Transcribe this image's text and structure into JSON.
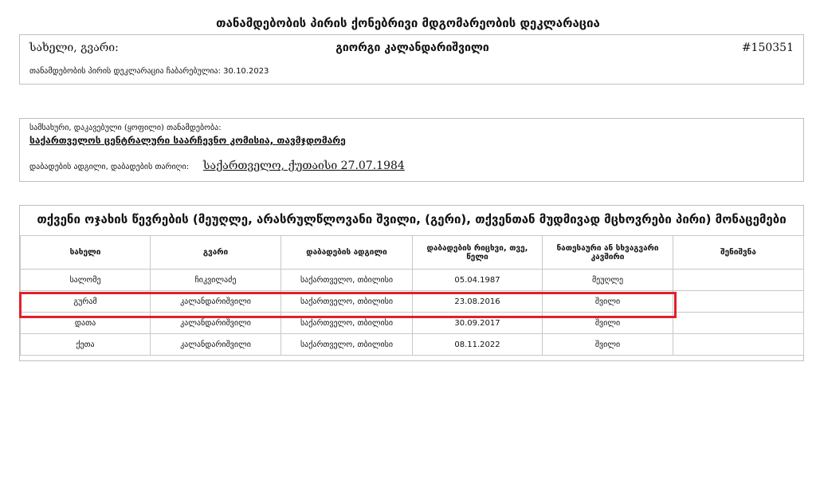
{
  "doc": {
    "title": "თანამდებობის პირის ქონებრივი მდგომარეობის დეკლარაცია"
  },
  "identity": {
    "name_label": "სახელი, გვარი:",
    "name_value": "გიორგი კალანდარიშვილი",
    "declaration_id": "#150351",
    "filed_text": "თანამდებობის პირის დეკლარაცია ჩაბარებულია: 30.10.2023"
  },
  "position": {
    "job_label": "სამსახური, დაკავებული (ყოფილი) თანამდებობა:",
    "job_value": "საქართველოს ცენტრალური საარჩევნო კომისია, თავმჯდომარე",
    "birth_label": "დაბადების ადგილი, დაბადების თარიღი:",
    "birth_value": "საქართველო, ქუთაისი 27.07.1984"
  },
  "family": {
    "title": "თქვენი ოჯახის წევრების (მეუღლე, არასრულწლოვანი შვილი, (გერი), თქვენთან მუდმივად მცხოვრები პირი) მონაცემები",
    "headers": [
      "სახელი",
      "გვარი",
      "დაბადების ადგილი",
      "დაბადების რიცხვი, თვე, წელი",
      "ნათესაური ან სხვაგვარი კავშირი",
      "შენიშვნა"
    ],
    "rows": [
      [
        "სალომე",
        "ჩიკვილაძე",
        "საქართველო, თბილისი",
        "05.04.1987",
        "მეუღლე",
        ""
      ],
      [
        "გურამ",
        "კალანდარიშვილი",
        "საქართველო, თბილისი",
        "23.08.2016",
        "შვილი",
        ""
      ],
      [
        "დათა",
        "კალანდარიშვილი",
        "საქართველო, თბილისი",
        "30.09.2017",
        "შვილი",
        ""
      ],
      [
        "ქეთა",
        "კალანდარიშვილი",
        "საქართველო, თბილისი",
        "08.11.2022",
        "შვილი",
        ""
      ]
    ],
    "highlight_color": "#e0202a"
  }
}
